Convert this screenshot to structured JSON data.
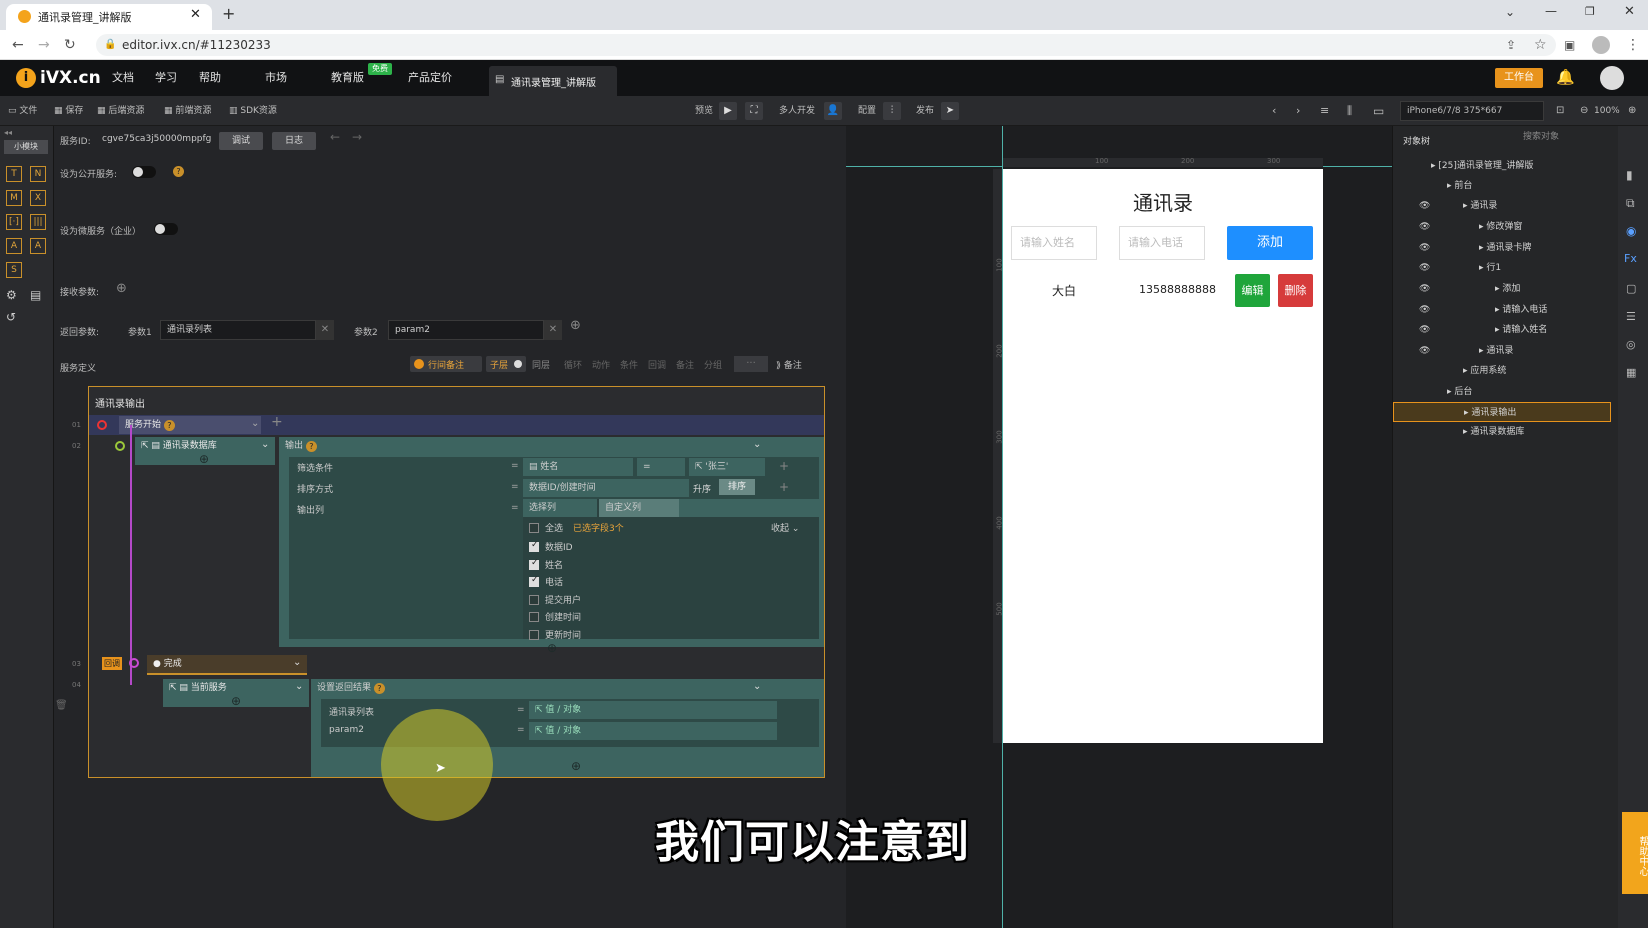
{
  "browser": {
    "tab_title": "通讯录管理_讲解版",
    "url": "editor.ivx.cn/#11230233"
  },
  "topnav": {
    "logo": "iVX.cn",
    "items": [
      "文档",
      "学习",
      "帮助",
      "市场",
      "教育版",
      "产品定价"
    ],
    "edu_badge": "免费",
    "project_tab": "通讯录管理_讲解版",
    "workbench": "工作台"
  },
  "toolbar": {
    "left": [
      "文件",
      "保存",
      "后端资源",
      "前端资源",
      "SDK资源"
    ],
    "preview": "预览",
    "multi_dev": "多人开发",
    "config": "配置",
    "publish": "发布",
    "device": "iPhone6/7/8 375*667",
    "zoom": "100%"
  },
  "leftbar": {
    "label": "小模块",
    "icons": [
      "T",
      "N",
      "M",
      "X",
      "[·]",
      "|||",
      "A",
      "A",
      "S"
    ]
  },
  "service": {
    "id_label": "服务ID:",
    "id_value": "cgve75ca3j50000mppfg",
    "debug_btn": "调试",
    "log_btn": "日志",
    "public_label": "设为公开服务:",
    "micro_label": "设为微服务（企业）",
    "receive_label": "接收参数:",
    "return_label": "返回参数:",
    "param1_label": "参数1",
    "param1_value": "通讯录列表",
    "param2_label": "参数2",
    "param2_value": "param2",
    "def_label": "服务定义",
    "def_tools": [
      "行间备注",
      "子层",
      "同层",
      "循环",
      "动作",
      "条件",
      "回调",
      "备注",
      "分组"
    ],
    "def_notes": "备注"
  },
  "flow": {
    "title": "通讯录输出",
    "line_nums": [
      "01",
      "02",
      "03",
      "04"
    ],
    "start": "服务开始",
    "db_node": "通讯录数据库",
    "output_label": "输出",
    "filter_label": "筛选条件",
    "filter_field": "姓名",
    "filter_op": "=",
    "filter_value": "'张三'",
    "sort_label": "排序方式",
    "sort_field": "数据ID/创建时间",
    "sort_asc": "升序",
    "sort_btn": "排序",
    "output_cols_label": "输出列",
    "select_col": "选择列",
    "custom_col": "自定义列",
    "select_all": "全选",
    "selected_count": "已选字段3个",
    "collapse": "收起",
    "fields": [
      {
        "name": "数据ID",
        "checked": true
      },
      {
        "name": "姓名",
        "checked": true
      },
      {
        "name": "电话",
        "checked": true
      },
      {
        "name": "提交用户",
        "checked": false
      },
      {
        "name": "创建时间",
        "checked": false
      },
      {
        "name": "更新时间",
        "checked": false
      }
    ],
    "callback_tag": "回调",
    "done_node": "完成",
    "current_service": "当前服务",
    "set_return": "设置返回结果",
    "ret1_label": "通讯录列表",
    "ret2_label": "param2",
    "value_placeholder": "值 / 对象"
  },
  "canvas": {
    "ruler": [
      "100",
      "200",
      "300"
    ],
    "side_ruler": [
      "100",
      "200",
      "300",
      "400",
      "500"
    ]
  },
  "phone": {
    "title": "通讯录",
    "name_placeholder": "请输入姓名",
    "phone_placeholder": "请输入电话",
    "add_btn": "添加",
    "row_name": "大白",
    "row_phone": "13588888888",
    "edit_btn": "编辑",
    "delete_btn": "删除"
  },
  "objectpanel": {
    "title": "对象树",
    "search_placeholder": "搜索对象",
    "items": [
      {
        "label": "[25]通讯录管理_讲解版",
        "indent": 0
      },
      {
        "label": "前台",
        "indent": 1
      },
      {
        "label": "通讯录",
        "indent": 2
      },
      {
        "label": "修改弹窗",
        "indent": 3
      },
      {
        "label": "通讯录卡牌",
        "indent": 3
      },
      {
        "label": "行1",
        "indent": 3
      },
      {
        "label": "添加",
        "indent": 4
      },
      {
        "label": "请输入电话",
        "indent": 4
      },
      {
        "label": "请输入姓名",
        "indent": 4
      },
      {
        "label": "通讯录",
        "indent": 3
      },
      {
        "label": "应用系统",
        "indent": 2
      },
      {
        "label": "后台",
        "indent": 1
      },
      {
        "label": "通讯录输出",
        "indent": 2
      },
      {
        "label": "通讯录数据库",
        "indent": 2
      }
    ]
  },
  "help_side": "帮助中心",
  "subtitle": "我们可以注意到",
  "colors": {
    "accent": "#c9902a",
    "add": "#1e8fff",
    "edit": "#1fa53b",
    "delete": "#d63b3b"
  }
}
